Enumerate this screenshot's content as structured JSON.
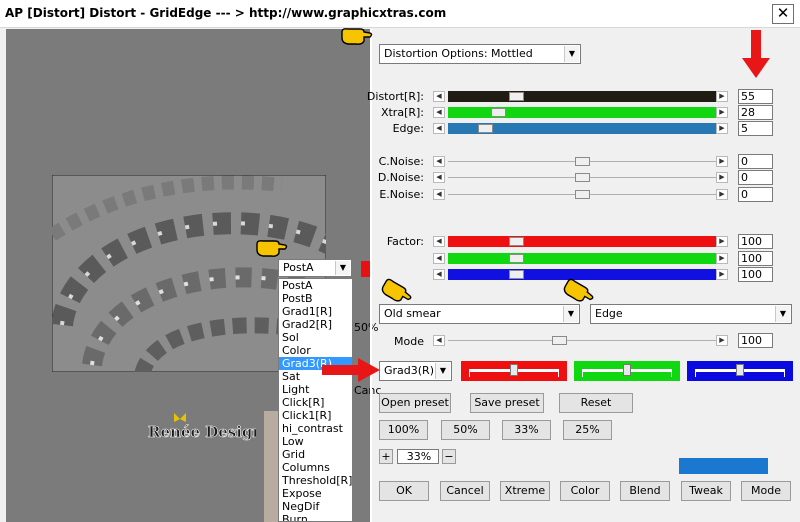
{
  "window": {
    "title": "AP [Distort]  Distort - GridEdge    --- > http://www.graphicxtras.com",
    "close_label": "✕"
  },
  "distortion_options": {
    "value": "Distortion Options: Mottled"
  },
  "sliders": [
    {
      "label": "Distort[R]:",
      "value": "55",
      "color": "#201c14",
      "level": 0.24
    },
    {
      "label": "Xtra[R]:",
      "value": "28",
      "color": "#13d613",
      "level": 0.17
    },
    {
      "label": "Edge:",
      "value": "5",
      "color": "#2878b4",
      "level": 0.12
    },
    {
      "label": "C.Noise:",
      "value": "0",
      "color": "#f0f0f0",
      "level": 0.5
    },
    {
      "label": "D.Noise:",
      "value": "0",
      "color": "#f0f0f0",
      "level": 0.5
    },
    {
      "label": "E.Noise:",
      "value": "0",
      "color": "#f0f0f0",
      "level": 0.5
    },
    {
      "label": "Factor:",
      "value": "100",
      "color": "#ee1010",
      "level": 0.24
    },
    {
      "label": "",
      "value": "100",
      "color": "#10d810",
      "level": 0.24
    },
    {
      "label": "",
      "value": "100",
      "color": "#1010e0",
      "level": 0.24
    }
  ],
  "smear_select": {
    "value": "Old smear"
  },
  "edge_select": {
    "value": "Edge"
  },
  "mode": {
    "label": "Mode",
    "value": "100",
    "level": 0.41
  },
  "grad_select": {
    "value": "Grad3(R)"
  },
  "color_boxes": [
    {
      "color": "#ee1010",
      "level": 0.5
    },
    {
      "color": "#10d810",
      "level": 0.5
    },
    {
      "color": "#0a0ae0",
      "level": 0.5
    }
  ],
  "preset_buttons": {
    "open": "Open preset",
    "save": "Save preset",
    "reset": "Reset"
  },
  "zoom_buttons": [
    "100%",
    "50%",
    "33%",
    "25%"
  ],
  "zoom": {
    "plus": "+",
    "value": "33%",
    "minus": "−"
  },
  "bottom_buttons": [
    "OK",
    "Cancel",
    "Xtreme",
    "Color",
    "Blend",
    "Tweak",
    "Mode"
  ],
  "blue_bar_color": "#1a78d0",
  "preview": {
    "combo_value": "PostA",
    "percent_partial": "50%",
    "cancel_partial": "Canc",
    "watermark": "Renée Design"
  },
  "dropdown_list": {
    "items": [
      "PostA",
      "PostB",
      "Grad1[R]",
      "Grad2[R]",
      "Sol",
      "Color",
      "Grad3(R)",
      "Sat",
      "Light",
      "Click[R]",
      "Click1[R]",
      "hi_contrast",
      "Low",
      "Grid",
      "Columns",
      "Threshold[R]",
      "Expose",
      "NegDif",
      "Burn"
    ],
    "selected_index": 6
  }
}
